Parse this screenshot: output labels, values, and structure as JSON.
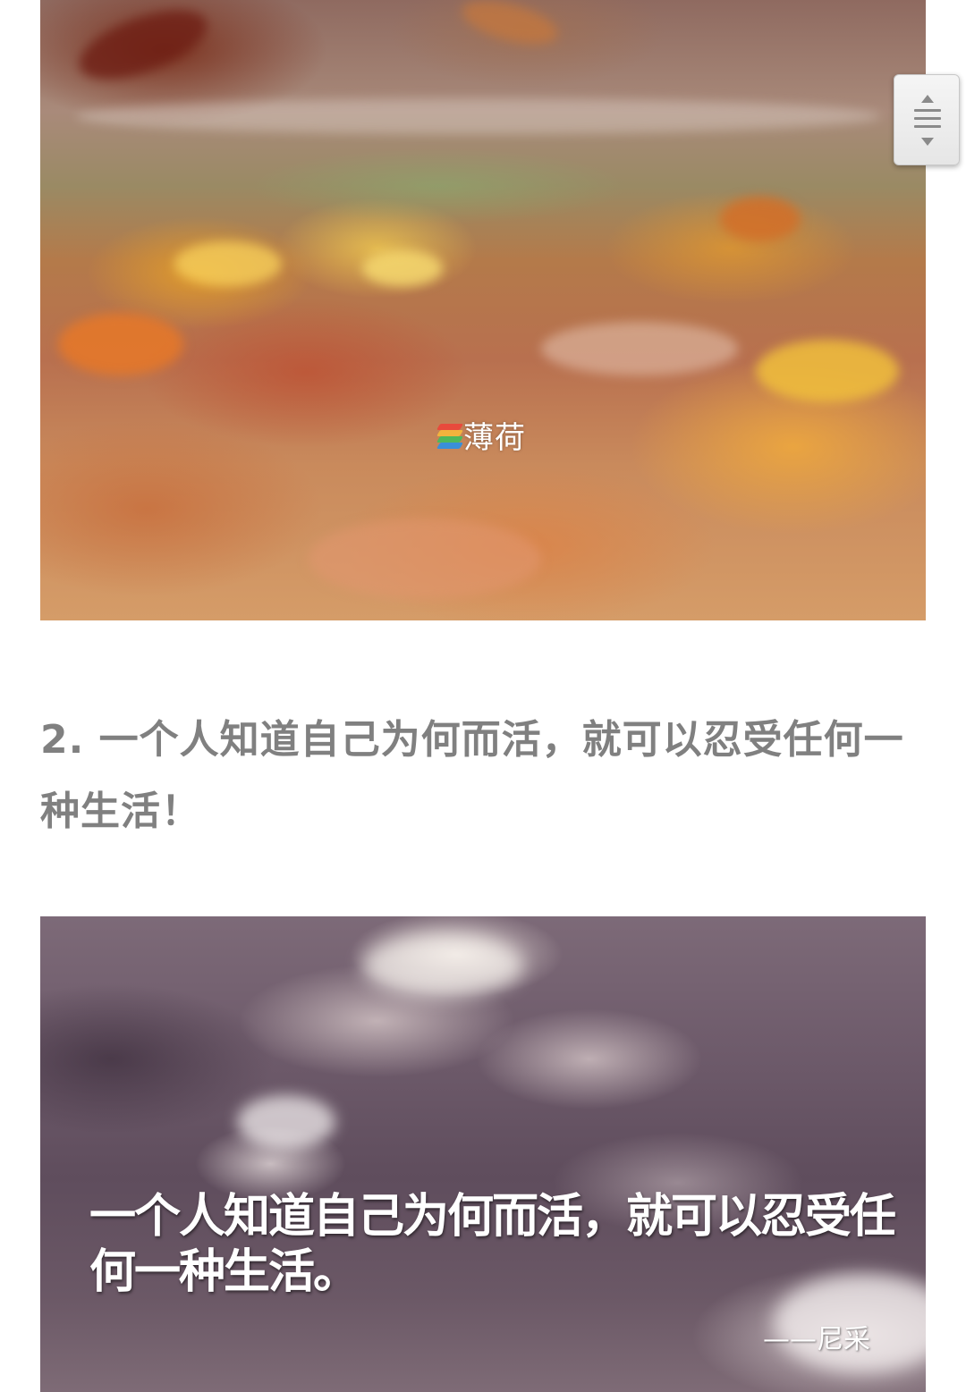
{
  "article": {
    "photo_1": {
      "alt": "",
      "watermark_text": "薄荷"
    },
    "heading": "2. 一个人知道自己为何而活，就可以忍受任何一种生活！",
    "photo_2": {
      "quote_text": "一个人知道自己为何而活，就可以忍受任何一种生活。",
      "author": "——尼采"
    }
  },
  "scroll_handle": {
    "icon": "scroll-handle-icon"
  },
  "colors": {
    "heading_text": "#808080",
    "page_background": "#ffffff",
    "watermark_stripes": [
      "#e84a3c",
      "#f2b33d",
      "#4fb85a",
      "#3a8fd8"
    ]
  }
}
